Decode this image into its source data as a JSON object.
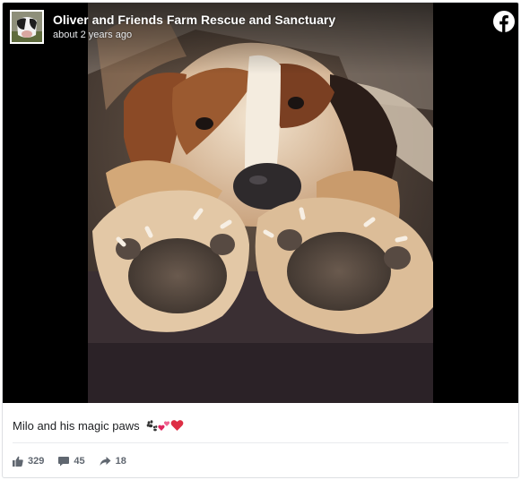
{
  "post": {
    "page_name": "Oliver and Friends Farm Rescue and Sanctuary",
    "timestamp": "about 2 years ago",
    "caption": "Milo and his magic paws",
    "caption_emoji_icons": [
      "paw-prints-icon",
      "two-hearts-icon",
      "red-heart-icon"
    ],
    "stats": {
      "likes": "329",
      "comments": "45",
      "shares": "18"
    }
  },
  "icons": {
    "platform_logo": "facebook-icon",
    "like": "thumbs-up-icon",
    "comment": "comment-icon",
    "share": "share-arrow-icon"
  },
  "colors": {
    "brand": "#1877f2",
    "heart": "#e0245e",
    "meta_text": "#606770"
  }
}
